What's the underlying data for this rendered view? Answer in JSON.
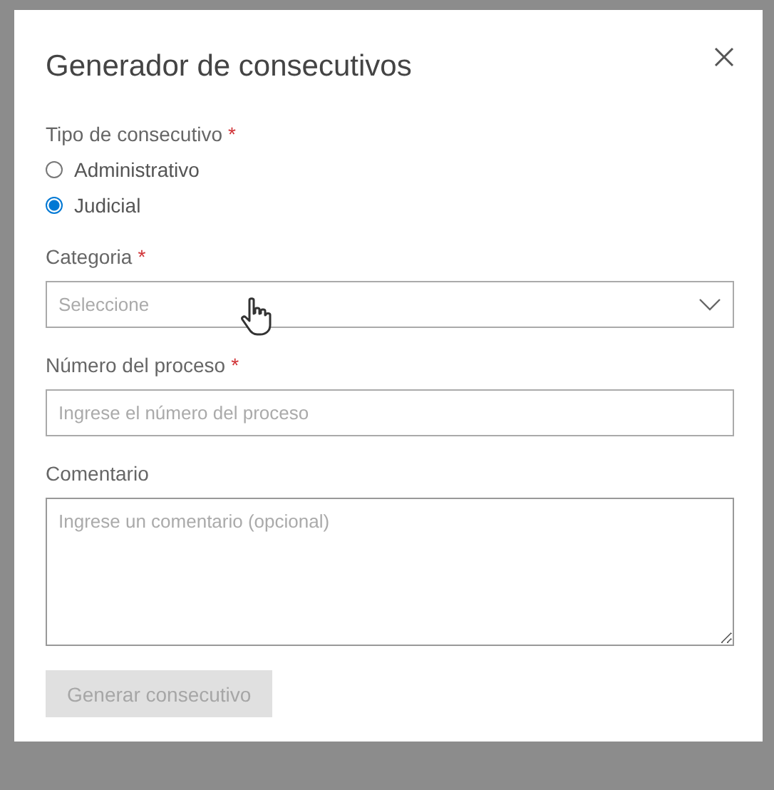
{
  "dialog": {
    "title": "Generador de consecutivos"
  },
  "type_field": {
    "label": "Tipo de consecutivo",
    "required_mark": "*",
    "options": [
      {
        "label": "Administrativo",
        "selected": false
      },
      {
        "label": "Judicial",
        "selected": true
      }
    ]
  },
  "category_field": {
    "label": "Categoria",
    "required_mark": "*",
    "placeholder": "Seleccione"
  },
  "process_field": {
    "label": "Número del proceso",
    "required_mark": "*",
    "placeholder": "Ingrese el número del proceso"
  },
  "comment_field": {
    "label": "Comentario",
    "placeholder": "Ingrese un comentario (opcional)"
  },
  "submit_button": {
    "label": "Generar consecutivo",
    "disabled": true
  }
}
